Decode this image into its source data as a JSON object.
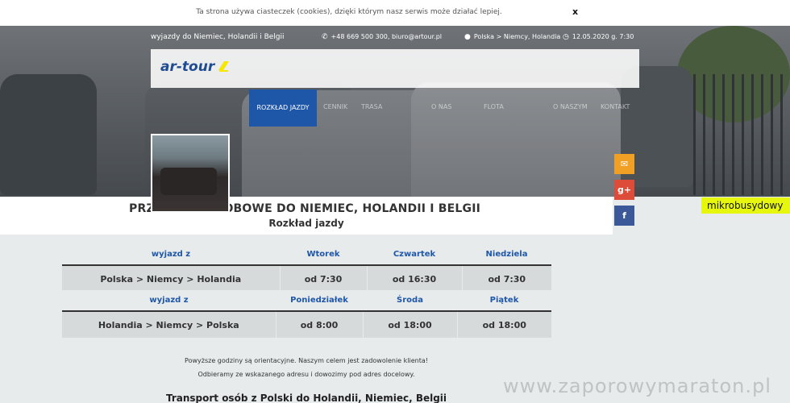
{
  "cookie": {
    "text": "Ta strona używa ciasteczek (cookies), dzięki którym nasz serwis może działać lepiej.",
    "close": "x"
  },
  "topbar": {
    "title": "wyjazdy do Niemiec, Holandii i Belgii",
    "contact": "+48 669 500 300, biuro@artour.pl",
    "route": "Polska > Niemcy, Holandia",
    "datetime": "12.05.2020 g. 7:30"
  },
  "logo": {
    "text": "ar-tour"
  },
  "nav": {
    "items": [
      "ROZKŁAD JAZDY",
      "CENNIK",
      "TRASA",
      "O NAS",
      "FLOTA",
      "O NASZYM",
      "KONTAKT"
    ]
  },
  "side_tag": "mikrobusydowy",
  "heading": {
    "title": "PRZEWOZY OSOBOWE DO NIEMIEC, HOLANDII I BELGII",
    "subtitle": "Rozkład jazdy"
  },
  "schedule": [
    {
      "headers": [
        "wyjazd z",
        "Wtorek",
        "Czwartek",
        "Niedziela"
      ],
      "row": [
        "Polska > Niemcy > Holandia",
        "od 7:30",
        "od 16:30",
        "od 7:30"
      ]
    },
    {
      "headers": [
        "wyjazd z",
        "Poniedziałek",
        "Środa",
        "Piątek"
      ],
      "row": [
        "Holandia > Niemcy > Polska",
        "od 8:00",
        "od 18:00",
        "od 18:00"
      ]
    }
  ],
  "notes": [
    "Powyższe godziny są orientacyjne. Naszym celem jest zadowolenie klienta!",
    "Odbieramy ze wskazanego adresu i dowozimy pod adres docelowy."
  ],
  "bottom_title": "Transport osób z Polski do Holandii, Niemiec, Belgii",
  "watermark": "www.zaporowymaraton.pl",
  "colors": {
    "accent": "#1f57a8",
    "tag": "#e6f70d",
    "mail": "#f0a025",
    "gplus": "#dd4b39",
    "facebook": "#3b5998"
  },
  "icons": [
    "phone-icon",
    "map-marker-icon",
    "clock-icon",
    "mail-icon",
    "google-plus-icon",
    "facebook-icon"
  ]
}
